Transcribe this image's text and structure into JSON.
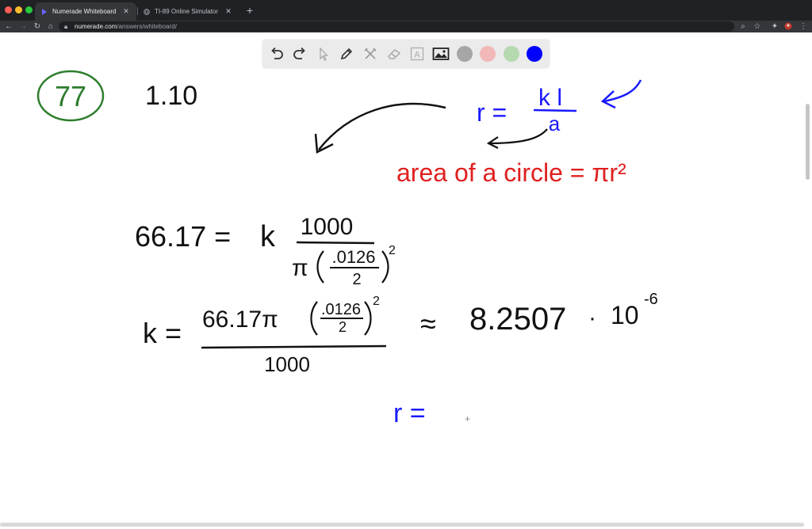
{
  "browser": {
    "tabs": [
      {
        "title": "Numerade Whiteboard",
        "active": true
      },
      {
        "title": "TI-89 Online Simulator",
        "active": false
      }
    ],
    "url_host": "numerade.com",
    "url_path": "/answers/whiteboard/",
    "colors": {
      "frame": "#202124",
      "toolbar": "#35363a",
      "accent_red": "#ff5f57",
      "accent_yellow": "#febc2e",
      "accent_green": "#28c840"
    }
  },
  "whiteboard": {
    "toolbar": {
      "tools": [
        "undo-icon",
        "redo-icon",
        "pointer-icon",
        "pen-icon",
        "tools-icon",
        "eraser-icon",
        "text-icon",
        "image-icon"
      ],
      "colors": [
        "#a6a6a6",
        "#f2b8b8",
        "#b7d9b0",
        "#0000ff"
      ],
      "text_tool_label": "A"
    },
    "ink": {
      "problem_number": "77",
      "problem_ref": "1.10",
      "formula_r": "r =",
      "formula_num": "k l",
      "formula_den": "a",
      "area_note": "area of a circle = πr²",
      "eq1_left": "66.17 =",
      "eq1_k": "k",
      "eq1_num": "1000",
      "eq1_den_pi": "π",
      "eq1_den_frac_num": ".0126",
      "eq1_den_frac_den": "2",
      "eq1_exp": "2",
      "eq2_left": "k =",
      "eq2_num": "66.17π",
      "eq2_frac_num": ".0126",
      "eq2_frac_den": "2",
      "eq2_exp": "2",
      "eq2_den": "1000",
      "approx": "≈",
      "result_mantissa": "8.2507",
      "result_dot": "·",
      "result_base": "10",
      "result_exp": "-6",
      "bottom_r": "r =",
      "cursor": "+",
      "ink_colors": {
        "black": "#111111",
        "blue": "#1a1aff",
        "red": "#e02020",
        "green": "#2e7d2e"
      }
    }
  }
}
